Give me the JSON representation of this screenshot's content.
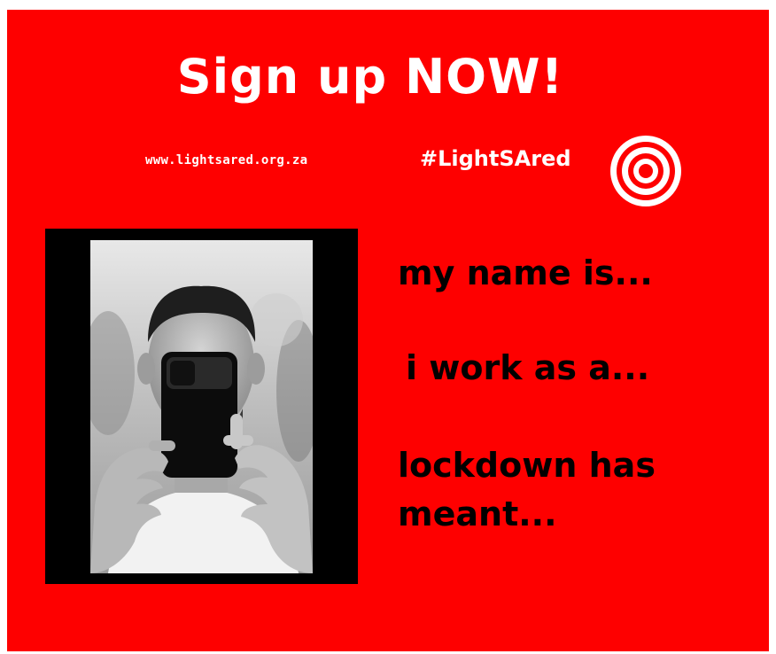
{
  "poster": {
    "headline": "Sign up NOW!",
    "url": "www.lightsared.org.za",
    "hashtag": "#LightSAred",
    "logo_icon": "target-icon",
    "photo_icon": "person-holding-phone-photo",
    "prompts": [
      "my name is...",
      "i work as a...",
      "lockdown has meant..."
    ],
    "colors": {
      "background": "#fe0000",
      "headline_text": "#ffffff",
      "prompt_text": "#000000",
      "photo_frame": "#000000"
    }
  }
}
